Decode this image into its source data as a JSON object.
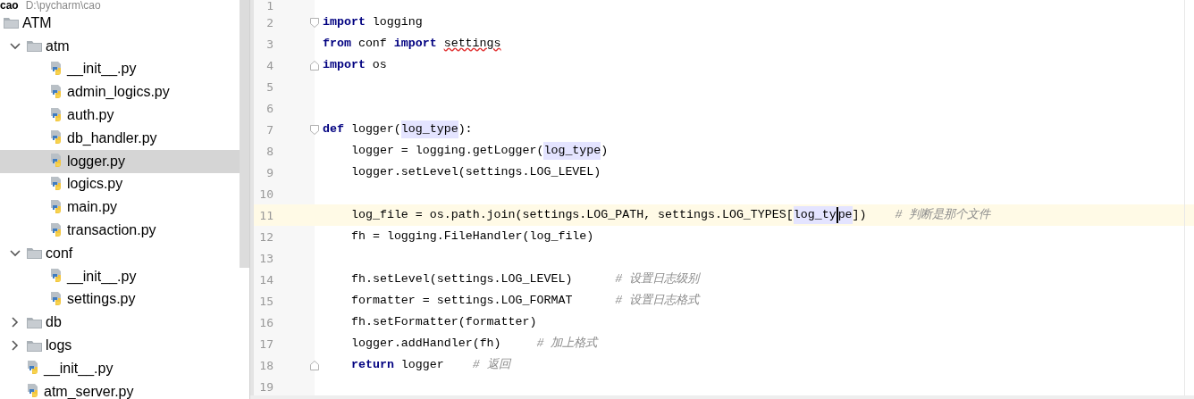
{
  "project": {
    "name": "cao",
    "path": "D:\\pycharm\\cao"
  },
  "tree": [
    {
      "kind": "folder",
      "label": "ATM",
      "children": [
        {
          "kind": "folder",
          "label": "atm",
          "expanded": true,
          "children": [
            {
              "kind": "file",
              "label": "__init__.py",
              "selected": false
            },
            {
              "kind": "file",
              "label": "admin_logics.py",
              "selected": false
            },
            {
              "kind": "file",
              "label": "auth.py",
              "selected": false
            },
            {
              "kind": "file",
              "label": "db_handler.py",
              "selected": false
            },
            {
              "kind": "file",
              "label": "logger.py",
              "selected": true
            },
            {
              "kind": "file",
              "label": "logics.py",
              "selected": false
            },
            {
              "kind": "file",
              "label": "main.py",
              "selected": false
            },
            {
              "kind": "file",
              "label": "transaction.py",
              "selected": false
            }
          ]
        },
        {
          "kind": "folder",
          "label": "conf",
          "expanded": true,
          "children": [
            {
              "kind": "file",
              "label": "__init__.py",
              "selected": false
            },
            {
              "kind": "file",
              "label": "settings.py",
              "selected": false
            }
          ]
        },
        {
          "kind": "folder",
          "label": "db",
          "expanded": false
        },
        {
          "kind": "folder",
          "label": "logs",
          "expanded": false
        },
        {
          "kind": "file",
          "label": "__init__.py",
          "selected": false
        },
        {
          "kind": "file",
          "label": "atm_server.py",
          "selected": false
        }
      ]
    }
  ],
  "code": [
    {
      "number": "1",
      "kind": "plain",
      "current": false
    },
    {
      "number": "2",
      "kind": "fold-start",
      "current": false,
      "segments": [
        {
          "kind": "kw",
          "text": "import"
        },
        {
          "kind": "text",
          "text": " logging"
        }
      ]
    },
    {
      "number": "3",
      "kind": "plain",
      "current": false,
      "segments": [
        {
          "kind": "kw",
          "text": "from"
        },
        {
          "kind": "text",
          "text": " conf "
        },
        {
          "kind": "kw",
          "text": "import"
        },
        {
          "kind": "warn",
          "text": "settings"
        }
      ]
    },
    {
      "number": "4",
      "kind": "fold-end",
      "current": false,
      "segments": [
        {
          "kind": "kw",
          "text": "import"
        },
        {
          "kind": "text",
          "text": " os"
        }
      ]
    },
    {
      "number": "5",
      "kind": "plain",
      "current": false
    },
    {
      "number": "6",
      "kind": "plain",
      "current": false
    },
    {
      "number": "7",
      "kind": "fold-start",
      "current": false,
      "segments": [
        {
          "kind": "kw",
          "text": "def"
        },
        {
          "kind": "text",
          "text": " logger("
        },
        {
          "kind": "hl",
          "text": "log_type"
        },
        {
          "kind": "text",
          "text": "):"
        }
      ]
    },
    {
      "number": "8",
      "kind": "plain",
      "indented": true,
      "current": false,
      "segments": [
        {
          "kind": "text",
          "text": "logger = logging.getLogger("
        },
        {
          "kind": "hl",
          "text": "log_type"
        },
        {
          "kind": "text",
          "text": ")"
        }
      ]
    },
    {
      "number": "9",
      "kind": "plain",
      "indented": true,
      "current": false,
      "segments": [
        {
          "kind": "text",
          "text": "logger.setLevel(settings.LOG_LEVEL)"
        }
      ]
    },
    {
      "number": "10",
      "kind": "plain",
      "current": false
    },
    {
      "number": "11",
      "kind": "plain",
      "indented": true,
      "current": true,
      "segments": [
        {
          "kind": "text",
          "text": "log_file = os.path.join(settings.LOG_PATH, settings.LOG_TYPES["
        },
        {
          "kind": "hl",
          "text": "log_ty"
        },
        {
          "kind": "caret"
        },
        {
          "kind": "hl",
          "text": "pe"
        },
        {
          "kind": "text",
          "text": "])    "
        },
        {
          "kind": "comment",
          "text": "# 判断是那个文件"
        }
      ]
    },
    {
      "number": "12",
      "kind": "plain",
      "indented": true,
      "current": false,
      "segments": [
        {
          "kind": "text",
          "text": "fh = logging.FileHandler(log_file)"
        }
      ]
    },
    {
      "number": "13",
      "kind": "plain",
      "current": false
    },
    {
      "number": "14",
      "kind": "plain",
      "indented": true,
      "current": false,
      "segments": [
        {
          "kind": "text",
          "text": "fh.setLevel(settings.LOG_LEVEL)      "
        },
        {
          "kind": "comment",
          "text": "# 设置日志级别"
        }
      ]
    },
    {
      "number": "15",
      "kind": "plain",
      "indented": true,
      "current": false,
      "segments": [
        {
          "kind": "text",
          "text": "formatter = settings.LOG_FORMAT      "
        },
        {
          "kind": "comment",
          "text": "# 设置日志格式"
        }
      ]
    },
    {
      "number": "16",
      "kind": "plain",
      "indented": true,
      "current": false,
      "segments": [
        {
          "kind": "text",
          "text": "fh.setFormatter(formatter)"
        }
      ]
    },
    {
      "number": "17",
      "kind": "plain",
      "indented": true,
      "current": false,
      "segments": [
        {
          "kind": "text",
          "text": "logger.addHandler(fh)     "
        },
        {
          "kind": "comment",
          "text": "# 加上格式"
        }
      ]
    },
    {
      "number": "18",
      "kind": "fold-end",
      "indented": true,
      "current": false,
      "segments": [
        {
          "kind": "kw",
          "text": "return"
        },
        {
          "kind": "text",
          "text": " logger    "
        },
        {
          "kind": "comment",
          "text": "# 返回"
        }
      ]
    },
    {
      "number": "19",
      "kind": "plain",
      "current": false
    }
  ]
}
